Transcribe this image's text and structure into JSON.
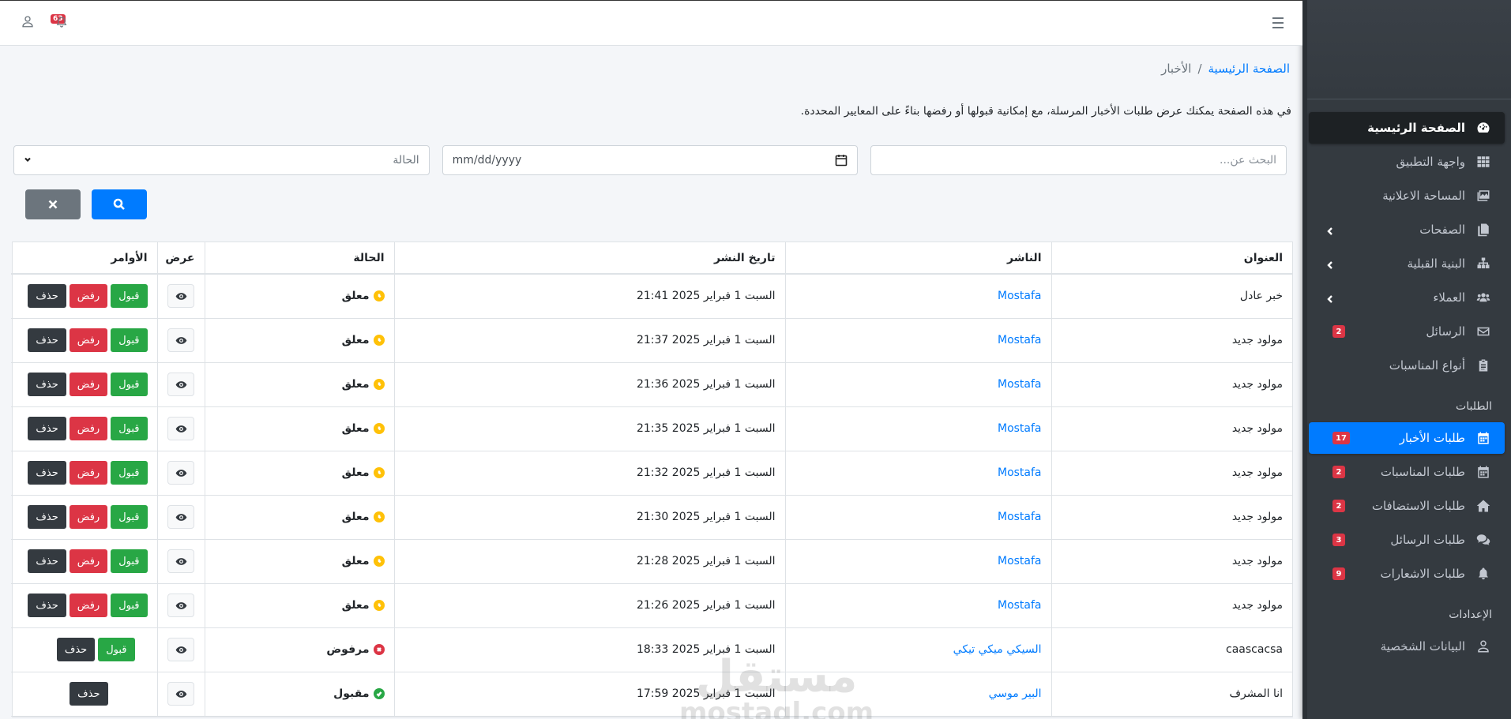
{
  "topbar": {
    "notification_count": "63"
  },
  "breadcrumb": {
    "home": "الصفحة الرئيسية",
    "separator": "/",
    "current": "الأخبار"
  },
  "intro_text": "في هذه الصفحة يمكنك عرض طلبات الأخبار المرسلة، مع إمكانية قبولها أو رفضها بناءً على المعايير المحددة.",
  "filters": {
    "search_placeholder": "البحث عن...",
    "date_placeholder": "mm/dd/yyyy",
    "status_placeholder": "الحالة"
  },
  "sidebar": {
    "items": [
      {
        "label": "الصفحة الرئيسية",
        "icon": "dashboard-icon"
      },
      {
        "label": "واجهة التطبيق",
        "icon": "grid-icon"
      },
      {
        "label": "المساحة الاعلانية",
        "icon": "images-icon"
      },
      {
        "label": "الصفحات",
        "icon": "copy-icon"
      },
      {
        "label": "البنية القبلية",
        "icon": "sitemap-icon"
      },
      {
        "label": "العملاء",
        "icon": "users-icon"
      },
      {
        "label": "الرسائل",
        "icon": "envelope-icon",
        "badge": "2"
      },
      {
        "label": "أنواع المناسبات",
        "icon": "clipboard-icon"
      }
    ],
    "requests_header": "الطلبات",
    "requests": [
      {
        "label": "طلبات الأخبار",
        "icon": "calendar-icon",
        "badge": "17"
      },
      {
        "label": "طلبات المناسبات",
        "icon": "calendar-icon",
        "badge": "2"
      },
      {
        "label": "طلبات الاستضافات",
        "icon": "home-icon",
        "badge": "2"
      },
      {
        "label": "طلبات الرسائل",
        "icon": "comments-icon",
        "badge": "3"
      },
      {
        "label": "طلبات الاشعارات",
        "icon": "bell-icon",
        "badge": "9"
      }
    ],
    "settings_header": "الإعدادات",
    "settings": [
      {
        "label": "البيانات الشخصية",
        "icon": "user-icon"
      }
    ]
  },
  "table": {
    "headers": {
      "title": "العنوان",
      "publisher": "الناشر",
      "date": "تاريخ النشر",
      "status": "الحالة",
      "view": "عرض",
      "actions": "الأوامر"
    },
    "buttons": {
      "accept": "قبول",
      "reject": "رفض",
      "delete": "حذف"
    },
    "rows": [
      {
        "title": "خبر عادل",
        "publisher": "Mostafa",
        "date": "السبت 1 فبراير 2025 21:41",
        "status": "معلق"
      },
      {
        "title": "مولود جديد",
        "publisher": "Mostafa",
        "date": "السبت 1 فبراير 2025 21:37",
        "status": "معلق"
      },
      {
        "title": "مولود جديد",
        "publisher": "Mostafa",
        "date": "السبت 1 فبراير 2025 21:36",
        "status": "معلق"
      },
      {
        "title": "مولود جديد",
        "publisher": "Mostafa",
        "date": "السبت 1 فبراير 2025 21:35",
        "status": "معلق"
      },
      {
        "title": "مولود جديد",
        "publisher": "Mostafa",
        "date": "السبت 1 فبراير 2025 21:32",
        "status": "معلق"
      },
      {
        "title": "مولود جديد",
        "publisher": "Mostafa",
        "date": "السبت 1 فبراير 2025 21:30",
        "status": "معلق"
      },
      {
        "title": "مولود جديد",
        "publisher": "Mostafa",
        "date": "السبت 1 فبراير 2025 21:28",
        "status": "معلق"
      },
      {
        "title": "مولود جديد",
        "publisher": "Mostafa",
        "date": "السبت 1 فبراير 2025 21:26",
        "status": "معلق"
      },
      {
        "title": "caascacsa",
        "publisher": "السيكي ميكي تيكي",
        "date": "السبت 1 فبراير 2025 18:33",
        "status": "مرفوض"
      },
      {
        "title": "انا المشرف",
        "publisher": "البير موسي",
        "date": "السبت 1 فبراير 2025 17:59",
        "status": "مقبول"
      }
    ]
  },
  "colors": {
    "sidebar_bg": "#343a40",
    "accent": "#007bff",
    "accept": "#28a745",
    "reject": "#dc3545",
    "pending": "#ffc107",
    "delete": "#343a40"
  },
  "watermark": {
    "line1": "مستقل",
    "line2": "mostaql.com"
  }
}
